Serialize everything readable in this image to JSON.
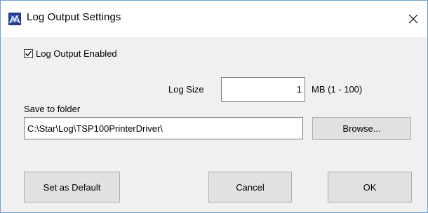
{
  "window": {
    "title": "Log Output Settings",
    "icon": "star-printer-app-icon",
    "close_icon": "close-icon"
  },
  "log_output": {
    "checkbox_label": "Log Output Enabled",
    "checked": true
  },
  "log_size": {
    "label": "Log Size",
    "value": "1",
    "unit_hint": "MB (1 - 100)"
  },
  "save_folder": {
    "label": "Save to folder",
    "path": "C:\\Star\\Log\\TSP100PrinterDriver\\",
    "browse_label": "Browse..."
  },
  "buttons": {
    "default_label": "Set as Default",
    "cancel_label": "Cancel",
    "ok_label": "OK"
  },
  "colors": {
    "window_border": "#6f9fd0",
    "dialog_bg": "#f0f0f0",
    "button_bg": "#e1e1e1",
    "button_border": "#adadad"
  }
}
